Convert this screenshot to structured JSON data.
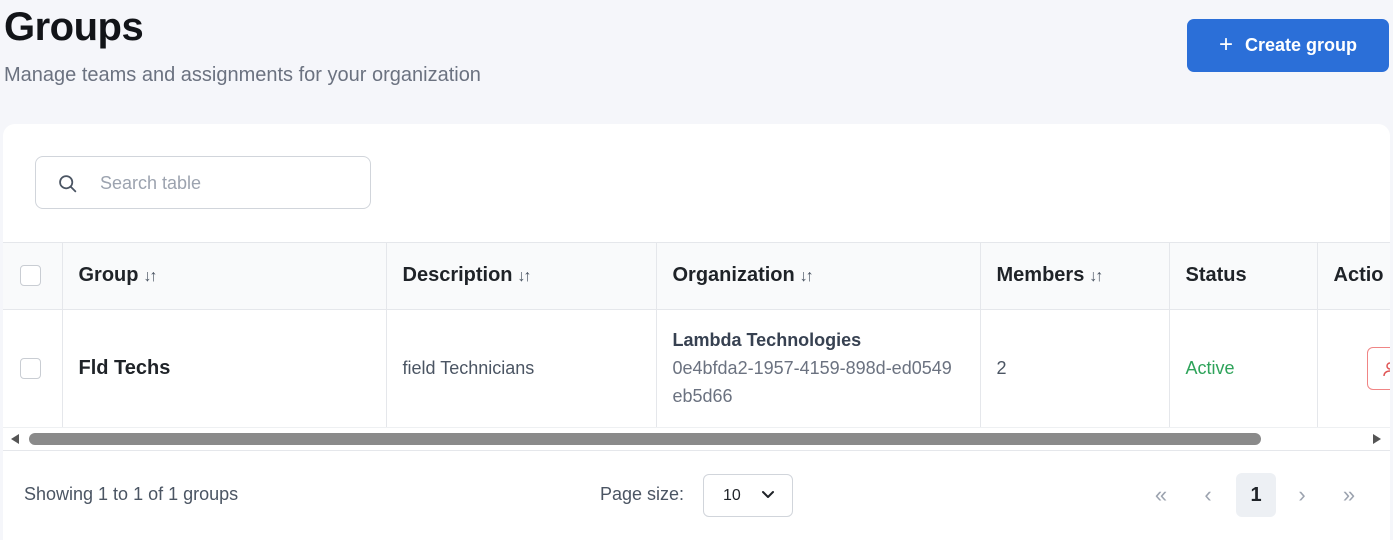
{
  "header": {
    "title": "Groups",
    "subtitle": "Manage teams and assignments for your organization",
    "create_button_label": "Create group",
    "create_button_icon": "plus-icon"
  },
  "search": {
    "placeholder": "Search table",
    "value": "",
    "icon": "search-icon"
  },
  "table": {
    "columns": [
      {
        "label": "Group",
        "sortable": true
      },
      {
        "label": "Description",
        "sortable": true
      },
      {
        "label": "Organization",
        "sortable": true
      },
      {
        "label": "Members",
        "sortable": true
      },
      {
        "label": "Status",
        "sortable": false
      },
      {
        "label": "Actio",
        "sortable": false
      }
    ],
    "sort_icon": "↓↑",
    "rows": [
      {
        "group": "Fld Techs",
        "description": "field Technicians",
        "organization_name": "Lambda Technologies",
        "organization_id": "0e4bfda2-1957-4159-898d-ed0549eb5d66",
        "members": "2",
        "status": "Active",
        "action_icon": "user-icon"
      }
    ]
  },
  "footer": {
    "showing": "Showing 1 to 1 of 1 groups",
    "page_size_label": "Page size:",
    "page_size_value": "10",
    "pager": {
      "first": "«",
      "prev": "‹",
      "current": "1",
      "next": "›",
      "last": "»"
    }
  },
  "colors": {
    "primary": "#2b6fd8",
    "status_active": "#2ea35a",
    "danger_outline": "#f08585",
    "page_bg": "#f5f6fa"
  }
}
